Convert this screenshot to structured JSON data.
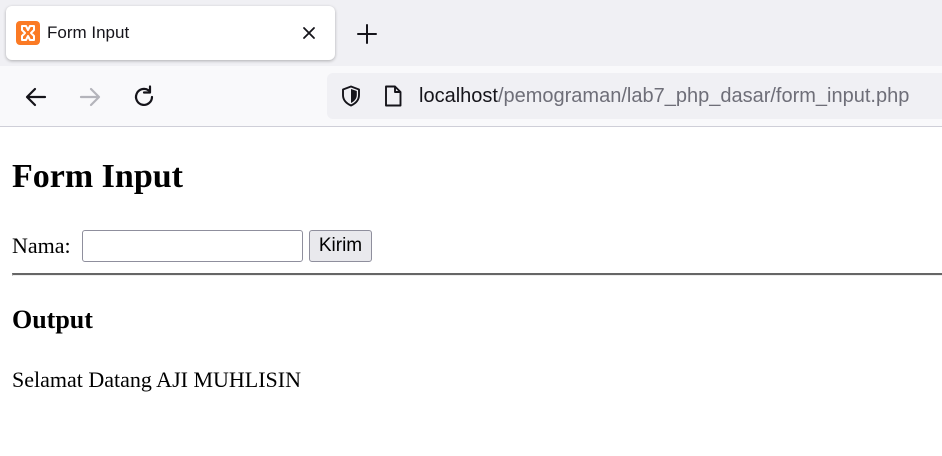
{
  "browser": {
    "tab": {
      "title": "Form Input",
      "favicon": "xampp-icon",
      "favicon_color": "#fb7a24"
    },
    "icons": {
      "close": "close-icon",
      "new_tab": "plus-icon",
      "back": "back-arrow-icon",
      "forward": "forward-arrow-icon",
      "reload": "reload-icon",
      "shield": "shield-icon",
      "page": "page-icon"
    },
    "address": {
      "host": "localhost",
      "path": "/pemograman/lab7_php_dasar/form_input.php"
    }
  },
  "page": {
    "title": "Form Input",
    "form": {
      "label": "Nama:",
      "input_value": "",
      "submit_label": "Kirim"
    },
    "output": {
      "heading": "Output",
      "message": "Selamat Datang AJI MUHLISIN"
    }
  }
}
